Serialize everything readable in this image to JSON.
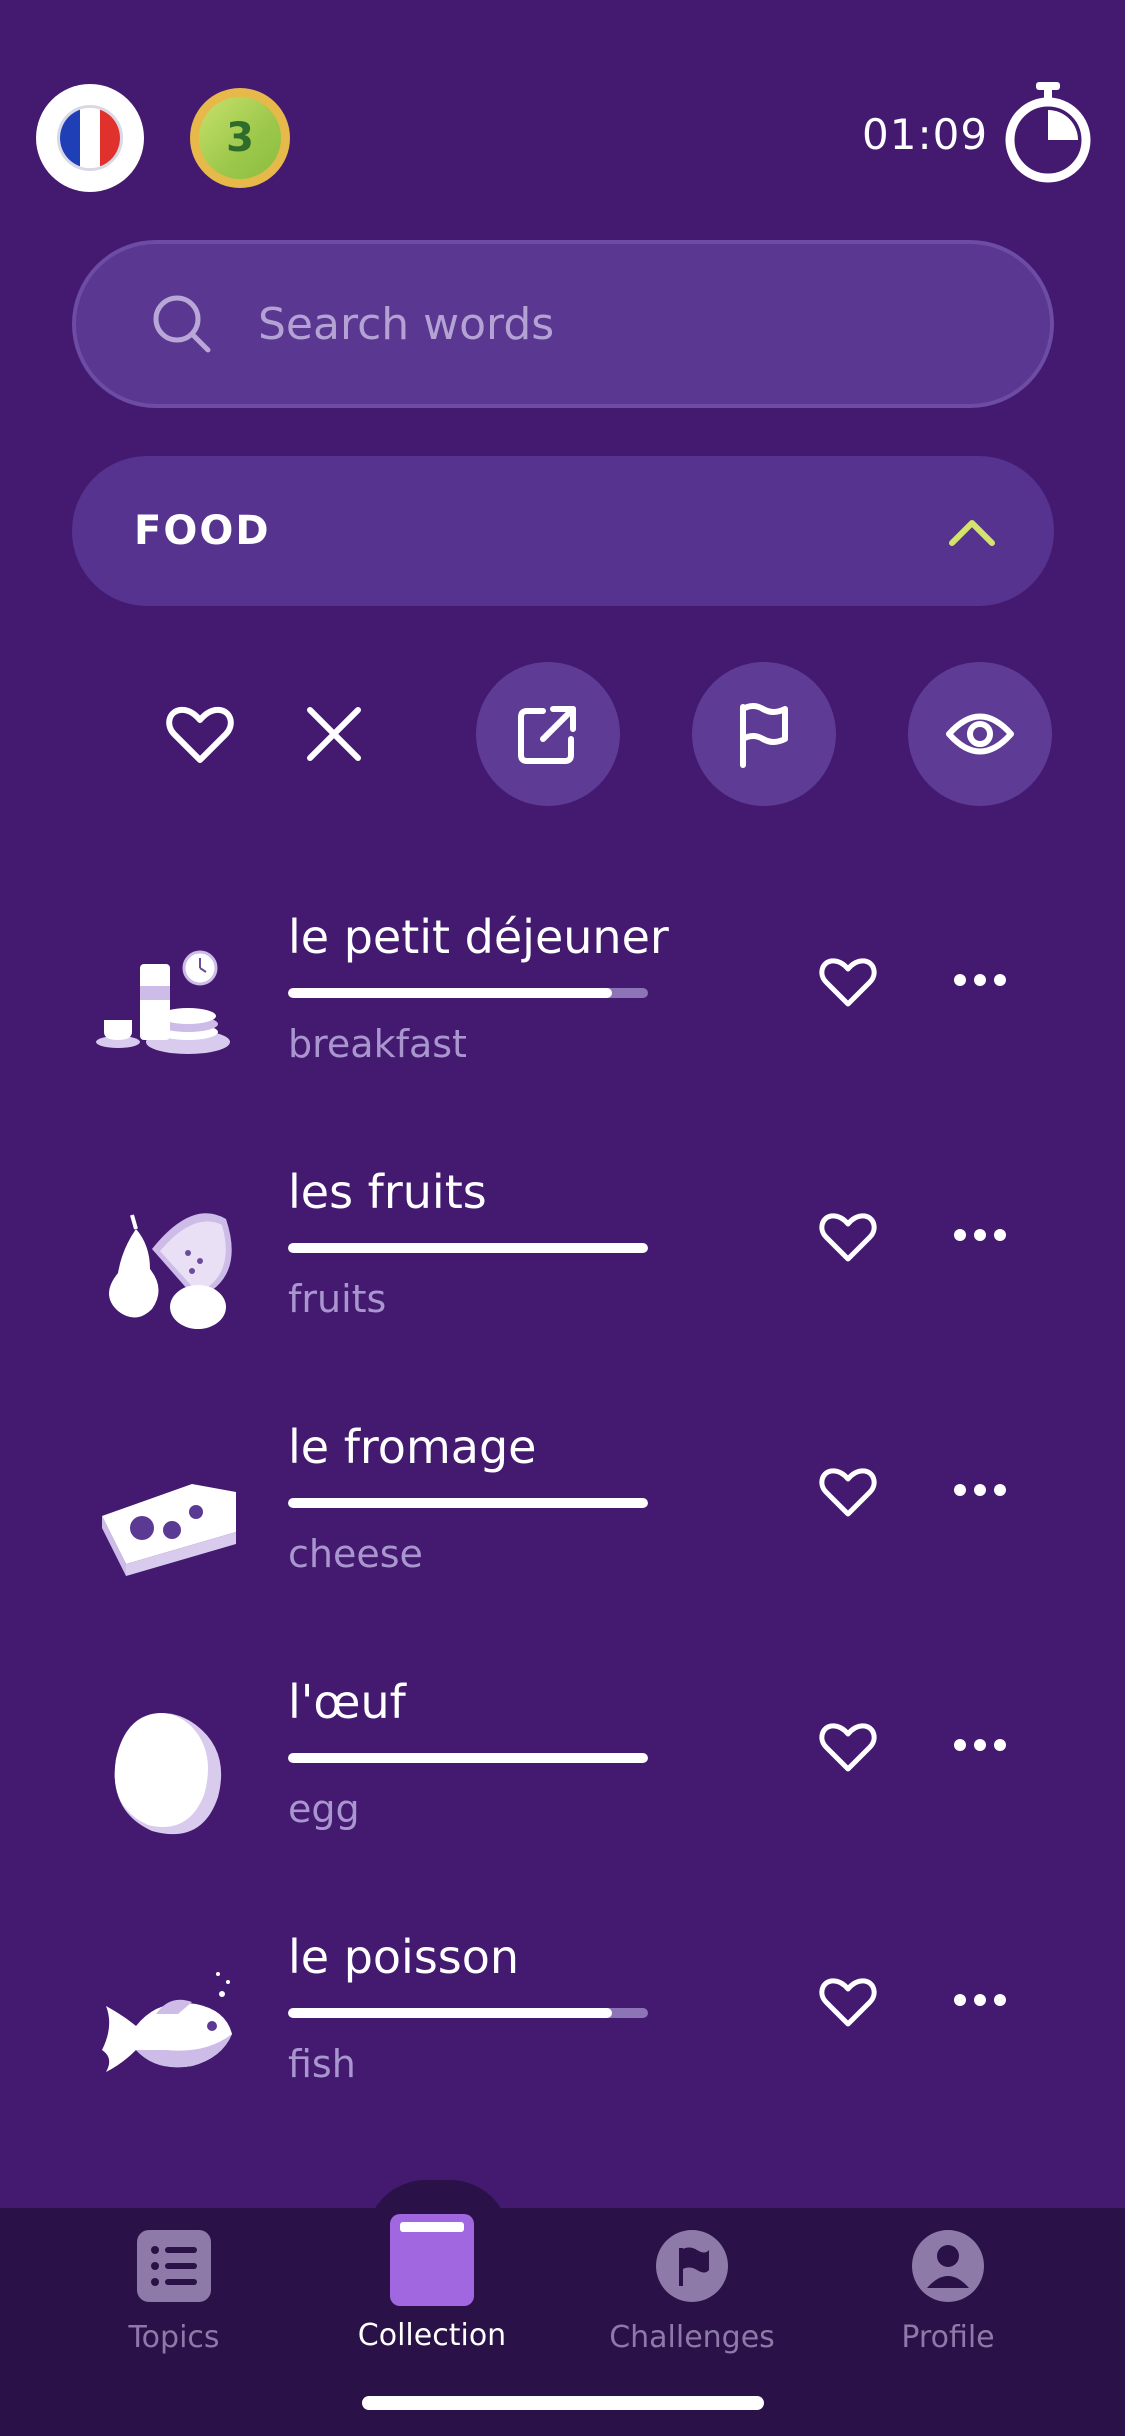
{
  "header": {
    "flag_colors": [
      "#1f3fb6",
      "#ffffff",
      "#e0312c"
    ],
    "level": "3",
    "timer": "01:09"
  },
  "search": {
    "placeholder": "Search words"
  },
  "category": {
    "title": "FOOD",
    "icon": "chevron-up-icon"
  },
  "toolbar": {
    "icons": [
      "heart-icon",
      "close-icon",
      "share-icon",
      "flag-icon",
      "eye-icon"
    ]
  },
  "words": [
    {
      "term": "le petit déjeuner",
      "translation": "breakfast",
      "progress": 0.9,
      "image": "breakfast-image"
    },
    {
      "term": "les fruits",
      "translation": "fruits",
      "progress": 1.0,
      "image": "fruits-image"
    },
    {
      "term": "le fromage",
      "translation": "cheese",
      "progress": 1.0,
      "image": "cheese-image"
    },
    {
      "term": "l'œuf",
      "translation": "egg",
      "progress": 1.0,
      "image": "egg-image"
    },
    {
      "term": "le poisson",
      "translation": "fish",
      "progress": 0.9,
      "image": "fish-image"
    }
  ],
  "nav": {
    "items": [
      {
        "label": "Topics",
        "icon": "list-icon",
        "active": false
      },
      {
        "label": "Collection",
        "icon": "book-icon",
        "active": true
      },
      {
        "label": "Challenges",
        "icon": "flag-icon",
        "active": false
      },
      {
        "label": "Profile",
        "icon": "user-icon",
        "active": false
      }
    ]
  },
  "colors": {
    "background": "#431a70",
    "accent": "#a067e0",
    "chevron": "#d4e36b",
    "nav_background": "#2a1147"
  }
}
